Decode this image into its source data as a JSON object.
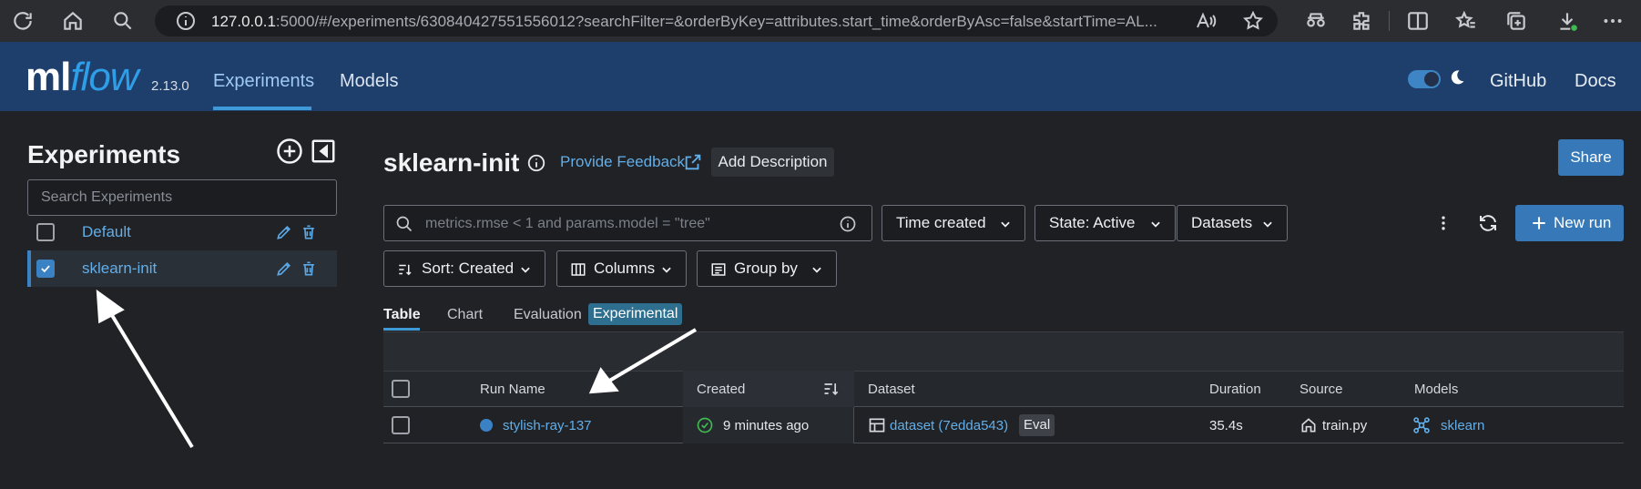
{
  "browser": {
    "url_host": "127.0.0.1",
    "url_rest": ":5000/#/experiments/630840427551556012?searchFilter=&orderByKey=attributes.start_time&orderByAsc=false&startTime=AL..."
  },
  "header": {
    "logo_ml": "ml",
    "logo_flow": "flow",
    "version": "2.13.0",
    "nav": [
      "Experiments",
      "Models"
    ],
    "links": [
      "GitHub",
      "Docs"
    ]
  },
  "sidebar": {
    "title": "Experiments",
    "search_placeholder": "Search Experiments",
    "experiments": [
      {
        "name": "Default",
        "checked": false
      },
      {
        "name": "sklearn-init",
        "checked": true
      }
    ]
  },
  "main": {
    "title": "sklearn-init",
    "feedback": "Provide Feedback",
    "add_description": "Add Description",
    "share": "Share",
    "search_placeholder": "metrics.rmse < 1 and params.model = \"tree\"",
    "filters": [
      "Time created",
      "State: Active",
      "Datasets"
    ],
    "controls": [
      "Sort: Created",
      "Columns",
      "Group by"
    ],
    "new_run": "New run",
    "tabs": [
      "Table",
      "Chart",
      "Evaluation"
    ],
    "experimental_badge": "Experimental"
  },
  "table": {
    "headers": [
      "Run Name",
      "Created",
      "Dataset",
      "Duration",
      "Source",
      "Models"
    ],
    "rows": [
      {
        "run_name": "stylish-ray-137",
        "created": "9 minutes ago",
        "dataset": "dataset (7edda543)",
        "dataset_tag": "Eval",
        "duration": "35.4s",
        "source": "train.py",
        "models": "sklearn"
      }
    ]
  },
  "colors": {
    "header_bg": "#1e3f6b",
    "accent": "#3678b8",
    "link": "#62aee8"
  }
}
